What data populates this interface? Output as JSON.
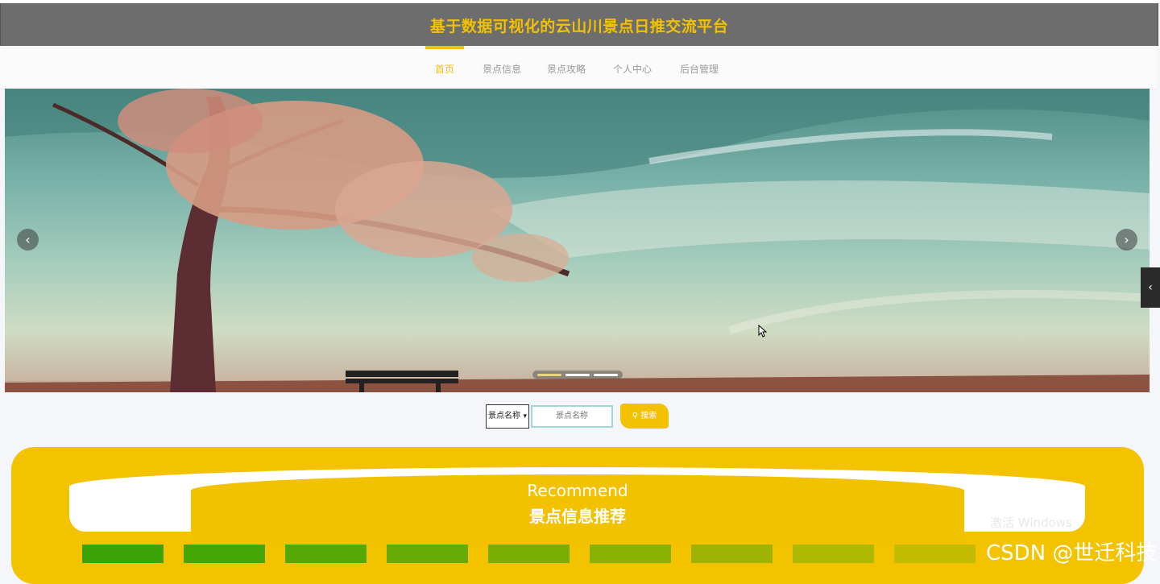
{
  "header": {
    "title": "基于数据可视化的云山川景点日推交流平台"
  },
  "nav": {
    "items": [
      {
        "label": "首页",
        "active": true
      },
      {
        "label": "景点信息",
        "active": false
      },
      {
        "label": "景点攻略",
        "active": false
      },
      {
        "label": "个人中心",
        "active": false
      },
      {
        "label": "后台管理",
        "active": false
      }
    ]
  },
  "carousel": {
    "prev_icon": "chevron-left-icon",
    "next_icon": "chevron-right-icon",
    "slide_count": 3,
    "active_index": 0
  },
  "search": {
    "select_value": "景点名称",
    "input_placeholder": "景点名称",
    "button_label": "搜索",
    "button_icon": "search-icon"
  },
  "recommend": {
    "title_en": "Recommend",
    "title_cn": "景点信息推荐"
  },
  "recommend_tabs": {
    "colors": [
      "#3aa307",
      "#45a606",
      "#55a905",
      "#66ab04",
      "#78ae03",
      "#8ab202",
      "#9db502",
      "#b0b901",
      "#c3bc01"
    ]
  },
  "overlay": {
    "activate_windows": "激活 Windows",
    "csdn_watermark": "CSDN @世迁科技"
  },
  "colors": {
    "accent": "#f2c100",
    "header_bg": "#6d6d6d"
  }
}
